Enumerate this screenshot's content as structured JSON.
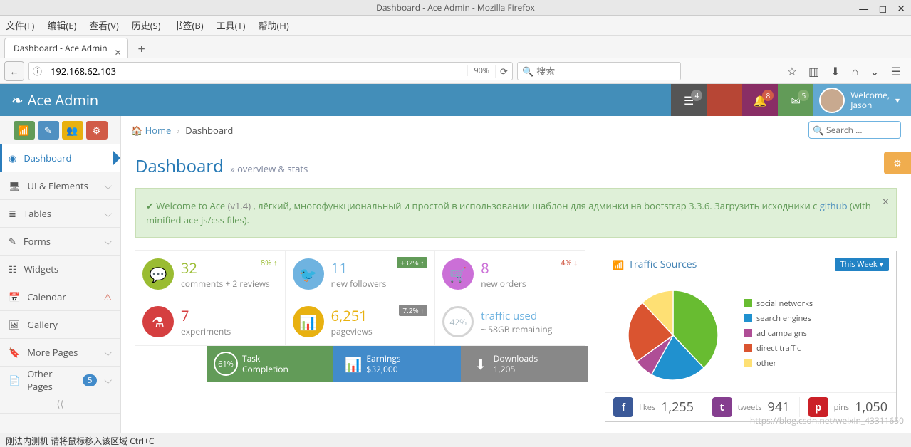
{
  "os": {
    "title": "Dashboard - Ace Admin - Mozilla Firefox",
    "menus": [
      "文件(F)",
      "编辑(E)",
      "查看(V)",
      "历史(S)",
      "书签(B)",
      "工具(T)",
      "帮助(H)"
    ]
  },
  "tab": {
    "title": "Dashboard - Ace Admin"
  },
  "url": {
    "address": "192.168.62.103",
    "zoom": "90%",
    "search_ph": "搜索"
  },
  "navbar": {
    "brand": "Ace Admin",
    "badges": {
      "tasks": "4",
      "notif": "8",
      "mail": "5"
    },
    "welcome": "Welcome,",
    "user": "Jason"
  },
  "sidebar": {
    "items": [
      {
        "label": "Dashboard",
        "icon": "◉",
        "active": true
      },
      {
        "label": "UI & Elements",
        "icon": "🖥",
        "chev": true
      },
      {
        "label": "Tables",
        "icon": "≣",
        "chev": true
      },
      {
        "label": "Forms",
        "icon": "✎",
        "chev": true
      },
      {
        "label": "Widgets",
        "icon": "☷"
      },
      {
        "label": "Calendar",
        "icon": "📅",
        "warn": true
      },
      {
        "label": "Gallery",
        "icon": "🖼"
      },
      {
        "label": "More Pages",
        "icon": "🔖",
        "chev": true
      },
      {
        "label": "Other Pages",
        "icon": "📄",
        "chev": true,
        "badge": "5"
      }
    ]
  },
  "breadcrumbs": {
    "home": "Home",
    "current": "Dashboard",
    "search_ph": "Search ..."
  },
  "page": {
    "title": "Dashboard",
    "subtitle": "overview & stats"
  },
  "alert": {
    "pre": "Welcome to ",
    "ace": "Ace",
    "ver": "(v1.4)",
    "text": " , лёгкий, многофункциональный и простой в использовании шаблон для админки на bootstrap 3.3.6. Загрузить исходники с ",
    "link": "github",
    "post": " (with minified ace js/css files)."
  },
  "infoboxes": [
    {
      "num": "32",
      "label": "comments + 2 reviews",
      "stat": "8%",
      "stat_dir": "↑",
      "color": "green"
    },
    {
      "num": "11",
      "label": "new followers",
      "badge": "+32%",
      "badge_color": "green",
      "color": "blue"
    },
    {
      "num": "8",
      "label": "new orders",
      "stat": "4%",
      "stat_dir": "↓",
      "color": "pink",
      "stat_color": "red"
    },
    {
      "num": "7",
      "label": "experiments",
      "color": "red"
    },
    {
      "num": "6,251",
      "label": "pageviews",
      "badge": "7.2%",
      "badge_color": "grey",
      "color": "orange"
    },
    {
      "num": "traffic used",
      "label": "~ 58GB remaining",
      "circle": "42%",
      "blue_title": true
    }
  ],
  "bigbtns": [
    {
      "circle": "61%",
      "l1": "Task",
      "l2": "Completion",
      "color": "g"
    },
    {
      "icon": "📊",
      "l1": "Earnings",
      "l2": "$32,000",
      "color": "b"
    },
    {
      "icon": "⬇",
      "l1": "Downloads",
      "l2": "1,205",
      "color": "gr"
    }
  ],
  "traffic": {
    "title": "Traffic Sources",
    "period": "This Week",
    "legend": [
      {
        "label": "social networks",
        "color": "#68bc31"
      },
      {
        "label": "search engines",
        "color": "#2091cf"
      },
      {
        "label": "ad campaigns",
        "color": "#af4e96"
      },
      {
        "label": "direct traffic",
        "color": "#da5430"
      },
      {
        "label": "other",
        "color": "#fee074"
      }
    ],
    "social": [
      {
        "icon": "f",
        "bg": "#3b5998",
        "label": "likes",
        "num": "1,255"
      },
      {
        "icon": "t",
        "bg": "#853e8f",
        "label": "tweets",
        "num": "941"
      },
      {
        "icon": "p",
        "bg": "#cb2027",
        "label": "pins",
        "num": "1,050"
      }
    ]
  },
  "chart_data": {
    "type": "pie",
    "title": "Traffic Sources",
    "series": [
      {
        "name": "social networks",
        "value": 38,
        "color": "#68bc31"
      },
      {
        "name": "search engines",
        "value": 20,
        "color": "#2091cf"
      },
      {
        "name": "ad campaigns",
        "value": 7,
        "color": "#af4e96"
      },
      {
        "name": "direct traffic",
        "value": 23,
        "color": "#da5430"
      },
      {
        "name": "other",
        "value": 12,
        "color": "#fee074"
      }
    ]
  },
  "status": "刚法内测机   请将鼠标移入该区域 Ctrl+C",
  "watermark": "https://blog.csdn.net/weixin_43311650"
}
